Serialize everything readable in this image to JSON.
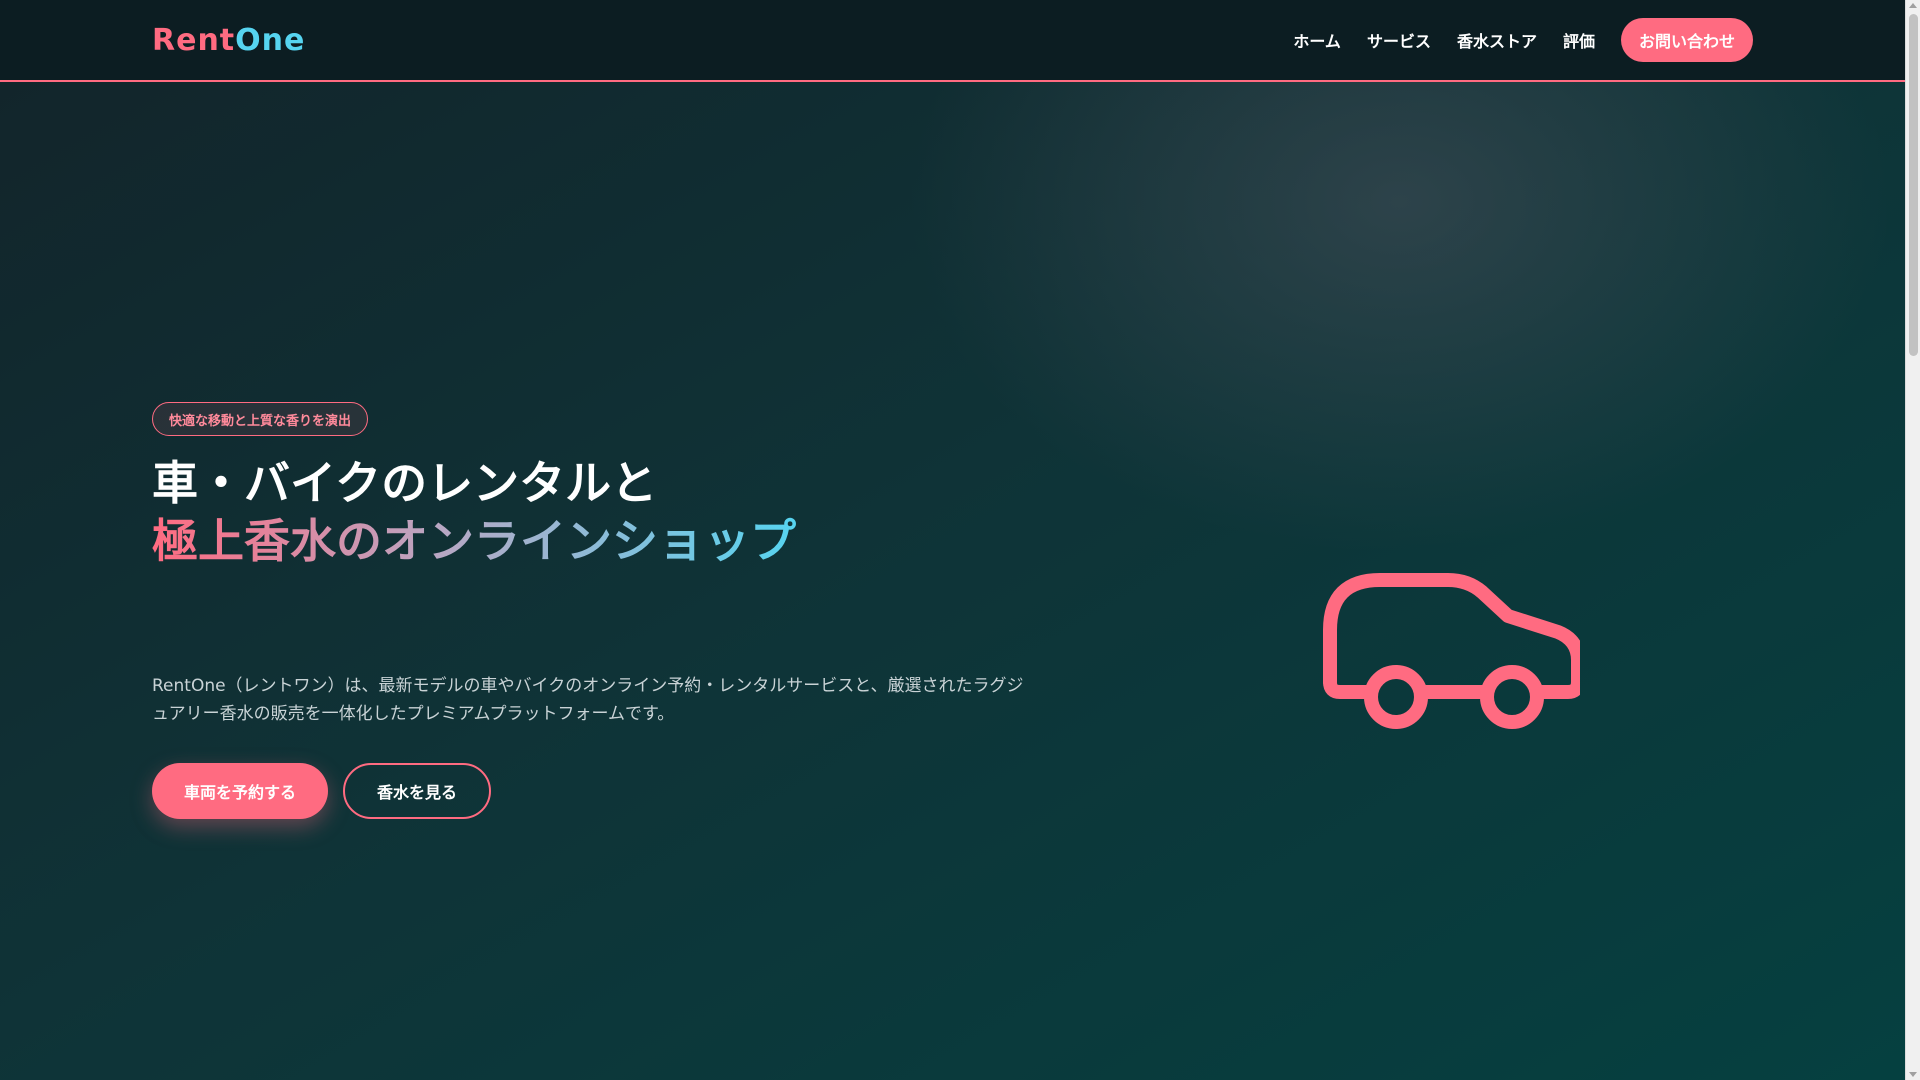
{
  "brand": {
    "name_part1": "Rent",
    "name_part2": "One"
  },
  "nav": {
    "items": [
      {
        "label": "ホーム"
      },
      {
        "label": "サービス"
      },
      {
        "label": "香水ストア"
      },
      {
        "label": "評価"
      }
    ],
    "cta_label": "お問い合わせ"
  },
  "hero": {
    "badge": "快適な移動と上質な香りを演出",
    "headline_line1": "車・バイクのレンタルと",
    "headline_line2": "極上香水のオンラインショップ",
    "description": "RentOne（レントワン）は、最新モデルの車やバイクのオンライン予約・レンタルサービスと、厳選されたラグジュアリー香水の販売を一体化したプレミアムプラットフォームです。",
    "primary_button": "車両を予約する",
    "secondary_button": "香水を見る",
    "illustration_icon": "car-icon"
  },
  "colors": {
    "accent": "#ff6b81",
    "accent_secondary": "#56d4f0",
    "header_bg": "#0c1d22",
    "hero_bg_end": "#054040"
  }
}
